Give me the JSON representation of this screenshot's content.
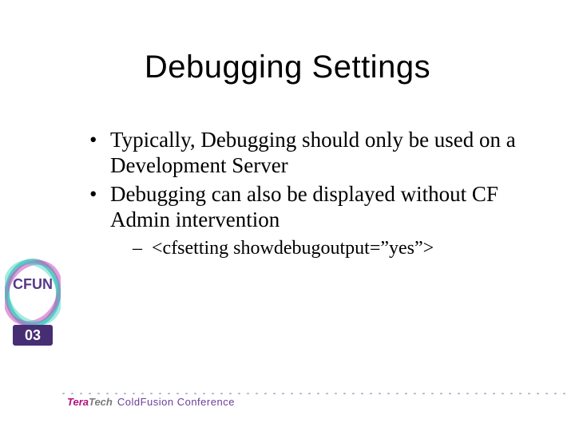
{
  "slide": {
    "title": "Debugging Settings",
    "bullets": [
      {
        "text": "Typically, Debugging should only be used on a Development Server",
        "children": []
      },
      {
        "text": "Debugging can also be displayed without CF Admin intervention",
        "children": [
          {
            "text": "<cfsetting showdebugoutput=”yes”>"
          }
        ]
      }
    ]
  },
  "logo": {
    "top_text": "CFUN",
    "bottom_text": "03"
  },
  "footer": {
    "brand_left": "Tera",
    "brand_right": "Tech",
    "tagline": "ColdFusion Conference"
  }
}
